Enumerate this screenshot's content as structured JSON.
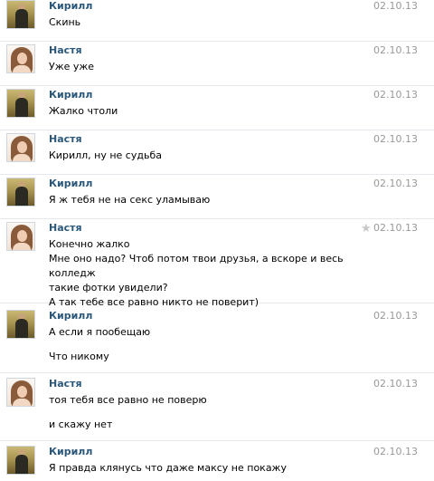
{
  "messages": [
    {
      "author": "Кирилл",
      "avatar": "kirill",
      "date": "02.10.13",
      "lines": [
        "Скинь"
      ]
    },
    {
      "author": "Настя",
      "avatar": "nastya",
      "date": "02.10.13",
      "lines": [
        "Уже уже"
      ]
    },
    {
      "author": "Кирилл",
      "avatar": "kirill",
      "date": "02.10.13",
      "lines": [
        "Жалко чтоли"
      ]
    },
    {
      "author": "Настя",
      "avatar": "nastya",
      "date": "02.10.13",
      "lines": [
        "Кирилл, ну не судьба"
      ]
    },
    {
      "author": "Кирилл",
      "avatar": "kirill",
      "date": "02.10.13",
      "lines": [
        "Я ж тебя не на секс уламываю"
      ]
    },
    {
      "author": "Настя",
      "avatar": "nastya",
      "date": "02.10.13",
      "starred_icon": "star-icon",
      "lines": [
        "Конечно жалко",
        "Мне оно надо? Чтоб потом твои друзья, а вскоре и весь колледж",
        "такие фотки увидели?",
        "А так тебе все равно никто не поверит)"
      ]
    },
    {
      "author": "Кирилл",
      "avatar": "kirill",
      "date": "02.10.13",
      "lines": [
        "А если я пообещаю"
      ],
      "followup": "Что никому"
    },
    {
      "author": "Настя",
      "avatar": "nastya",
      "date": "02.10.13",
      "lines": [
        "тоя тебя все равно не поверю"
      ],
      "followup": "и скажу нет"
    },
    {
      "author": "Кирилл",
      "avatar": "kirill",
      "date": "02.10.13",
      "lines": [
        "Я правда клянусь что даже максу не покажу"
      ]
    }
  ]
}
